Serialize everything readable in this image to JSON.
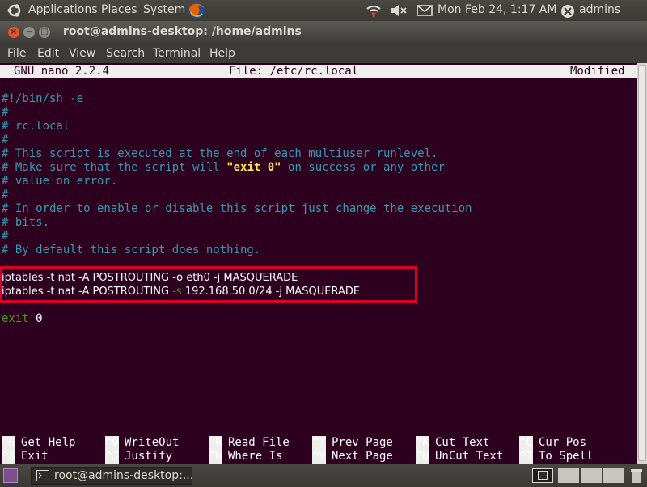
{
  "top_panel": {
    "applications": "Applications",
    "places": "Places",
    "system": "System",
    "datetime": "Mon Feb 24,  1:17 AM",
    "user": "admins"
  },
  "window": {
    "title": "root@admins-desktop: /home/admins"
  },
  "menubar": [
    "File",
    "Edit",
    "View",
    "Search",
    "Terminal",
    "Help"
  ],
  "nano": {
    "version": "GNU nano 2.2.4",
    "file": "File: /etc/rc.local",
    "status": "Modified",
    "lines": [
      "#!/bin/sh -e",
      "#",
      "# rc.local",
      "#",
      "# This script is executed at the end of each multiuser runlevel.",
      "# Make sure that the script will ",
      "\"exit 0\"",
      " on success or any other",
      "# value on error.",
      "#",
      "# In order to enable or disable this script just change the execution",
      "# bits.",
      "#",
      "# By default this script does nothing.",
      "iptables -t nat -A POSTROUTING -o eth0 -j MASQUERADE",
      "iptables -t nat -A POSTROUTING ",
      "-s",
      " 192.168.50.0/24 -j MASQUERADE",
      "exit",
      " 0"
    ],
    "shortcuts": [
      {
        "key": "^G",
        "label": "Get Help"
      },
      {
        "key": "^O",
        "label": "WriteOut"
      },
      {
        "key": "^R",
        "label": "Read File"
      },
      {
        "key": "^Y",
        "label": "Prev Page"
      },
      {
        "key": "^K",
        "label": "Cut Text"
      },
      {
        "key": "^C",
        "label": "Cur Pos"
      },
      {
        "key": "^X",
        "label": "Exit"
      },
      {
        "key": "^J",
        "label": "Justify"
      },
      {
        "key": "^W",
        "label": "Where Is"
      },
      {
        "key": "^V",
        "label": "Next Page"
      },
      {
        "key": "^U",
        "label": "UnCut Text"
      },
      {
        "key": "^T",
        "label": "To Spell"
      }
    ]
  },
  "taskbar": {
    "task_label": "root@admins-desktop:..."
  },
  "colors": {
    "terminal_bg": "#2c001e",
    "comment": "#389bb0",
    "highlight": "#fce94f",
    "keyword_green": "#4e9a06",
    "annotation_red": "#d7002d"
  }
}
